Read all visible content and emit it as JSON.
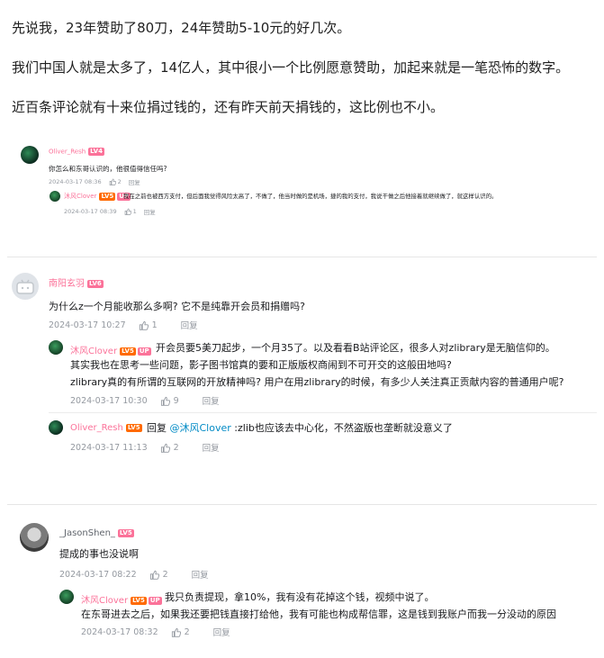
{
  "intro": {
    "p1": "先说我，23年赞助了80刀，24年赞助5-10元的好几次。",
    "p2": "我们中国人就是太多了，14亿人，其中很小一个比例愿意赞助，加起来就是一笔恐怖的数字。",
    "p3": "近百条评论就有十来位捐过钱的，还有昨天前天捐钱的，这比例也不小。"
  },
  "card1": {
    "user": "Oliver_Resh",
    "level": "LV4",
    "text": "你怎么和东哥认识的，他很值得信任吗?",
    "time": "2024-03-17 08:36",
    "likes": "2",
    "reply_label": "回复",
    "reply": {
      "user": "沐风Clover",
      "level": "LV5",
      "up": "UP",
      "text": "我在之前也被西方支付，但后面我觉得风险太高了，不做了，他当时做的是机场，捷的我的支付，我说干做之后他接着就继续做了，就这样认识的。",
      "time": "2024-03-17 08:39",
      "likes": "1",
      "reply_label": "回复"
    }
  },
  "card2": {
    "user": "南阳玄羽",
    "level": "LV6",
    "text": "为什么z一个月能收那么多啊? 它不是纯靠开会员和捐赠吗?",
    "time": "2024-03-17 10:27",
    "likes": "1",
    "reply_label": "回复",
    "replies": [
      {
        "user": "沐风Clover",
        "level": "LV5",
        "up": "UP",
        "line1": "开会员要5美刀起步，一个月35了。以及看看B站评论区，很多人对zlibrary是无脑信仰的。",
        "line2": "其实我也在思考一些问题，影子图书馆真的要和正版版权商闹到不可开交的这般田地吗?",
        "line3": "zlibrary真的有所谓的互联网的开放精神吗? 用户在用zlibrary的时候，有多少人关注真正贡献内容的普通用户呢?",
        "time": "2024-03-17 10:30",
        "likes": "9",
        "reply_label": "回复"
      },
      {
        "user": "Oliver_Resh",
        "level": "LV5",
        "prefix": "回复 ",
        "mention": "@沐风Clover",
        "text": " :zlib也应该去中心化，不然盗版也垄断就没意义了",
        "time": "2024-03-17 11:13",
        "likes": "2",
        "reply_label": "回复"
      }
    ]
  },
  "card3": {
    "user": "_JasonShen_",
    "level": "LV5",
    "text": "提成的事也没说啊",
    "time": "2024-03-17 08:22",
    "likes": "2",
    "reply_label": "回复",
    "reply": {
      "user": "沐风Clover",
      "level": "LV5",
      "up": "UP",
      "line1": "我只负责提现，拿10%，我有没有花掉这个钱，视频中说了。",
      "line2": "在东哥进去之后，如果我还要把钱直接打给他，我有可能也构成帮信罪，这是钱到我账户而我一分没动的原因",
      "time": "2024-03-17 08:32",
      "likes": "2",
      "reply_label": "回复"
    }
  }
}
